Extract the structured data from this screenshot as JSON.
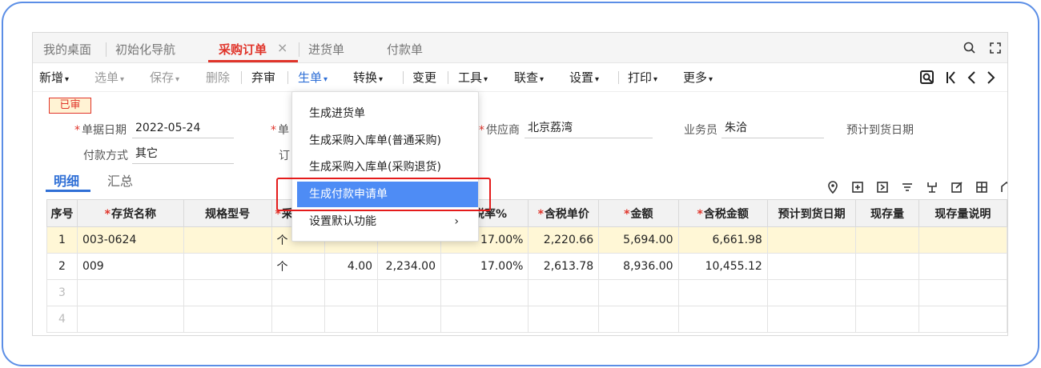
{
  "tabs": [
    {
      "label": "我的桌面"
    },
    {
      "label": "初始化导航"
    },
    {
      "label": "采购订单"
    },
    {
      "label": "进货单"
    },
    {
      "label": "付款单"
    }
  ],
  "tab_close_glyph": "×",
  "toolbar": {
    "items": [
      {
        "label": "新增"
      },
      {
        "label": "选单"
      },
      {
        "label": "保存"
      },
      {
        "label": "删除"
      },
      {
        "label": "弃审"
      },
      {
        "label": "生单"
      },
      {
        "label": "转换"
      },
      {
        "label": "变更"
      },
      {
        "label": "工具"
      },
      {
        "label": "联查"
      },
      {
        "label": "设置"
      },
      {
        "label": "打印"
      },
      {
        "label": "更多"
      }
    ],
    "caret": "▾"
  },
  "status_badge": "已审",
  "form": {
    "doc_date_label": "单据日期",
    "doc_date_value": "2022-05-24",
    "doc_no_label_partial": "单",
    "supplier_label": "供应商",
    "supplier_value": "北京荔湾",
    "salesman_label": "业务员",
    "salesman_value": "朱洽",
    "expected_date_label": "预计到货日期",
    "payment_label": "付款方式",
    "payment_value": "其它",
    "order_label_partial": "订"
  },
  "subtabs": [
    {
      "label": "明细"
    },
    {
      "label": "汇总"
    }
  ],
  "grid": {
    "headers": [
      "序号",
      "存货名称",
      "规格型号",
      "采",
      "",
      "",
      "税率%",
      "含税单价",
      "金额",
      "含税金额",
      "预计到货日期",
      "现存量",
      "现存量说明"
    ],
    "required_headers": [
      1,
      3,
      7,
      8,
      9
    ],
    "rows": [
      {
        "no": "1",
        "name": "003-0624",
        "spec": "",
        "unit": "个",
        "qty": "",
        "price": "",
        "tax": "17.00%",
        "taxprice": "2,220.66",
        "amount": "5,694.00",
        "taxamount": "6,661.98",
        "date": "",
        "stock": "",
        "stocknote": ""
      },
      {
        "no": "2",
        "name": "009",
        "spec": "",
        "unit": "个",
        "qty": "4.00",
        "price": "2,234.00",
        "tax": "17.00%",
        "taxprice": "2,613.78",
        "amount": "8,936.00",
        "taxamount": "10,455.12",
        "date": "",
        "stock": "",
        "stocknote": ""
      },
      {
        "no": "3",
        "name": "",
        "spec": "",
        "unit": "",
        "qty": "",
        "price": "",
        "tax": "",
        "taxprice": "",
        "amount": "",
        "taxamount": "",
        "date": "",
        "stock": "",
        "stocknote": ""
      },
      {
        "no": "4",
        "name": "",
        "spec": "",
        "unit": "",
        "qty": "",
        "price": "",
        "tax": "",
        "taxprice": "",
        "amount": "",
        "taxamount": "",
        "date": "",
        "stock": "",
        "stocknote": ""
      }
    ]
  },
  "dropdown": {
    "items": [
      {
        "label": "生成进货单"
      },
      {
        "label": "生成采购入库单(普通采购)"
      },
      {
        "label": "生成采购入库单(采购退货)"
      },
      {
        "label": "生成付款申请单"
      },
      {
        "label": "设置默认功能"
      }
    ],
    "submenu_arrow": "›"
  },
  "colors": {
    "accent_red": "#e0342a",
    "accent_blue": "#2f6fd6",
    "highlight_blue": "#4e8cf5",
    "selected_row": "#fff7d6",
    "frame_blue": "#5b8ee6"
  },
  "icons": {
    "tabbar_right": [
      "search-icon",
      "fullscreen-icon"
    ],
    "toolbar_right": [
      "preview-icon",
      "first-record-icon",
      "previous-record-icon",
      "next-record-icon"
    ],
    "grid_toolbar": [
      "location-icon",
      "add-row-icon",
      "export-icon",
      "filter-icon",
      "split-icon",
      "edit-icon",
      "grid-layout-icon",
      "more-icon"
    ]
  }
}
